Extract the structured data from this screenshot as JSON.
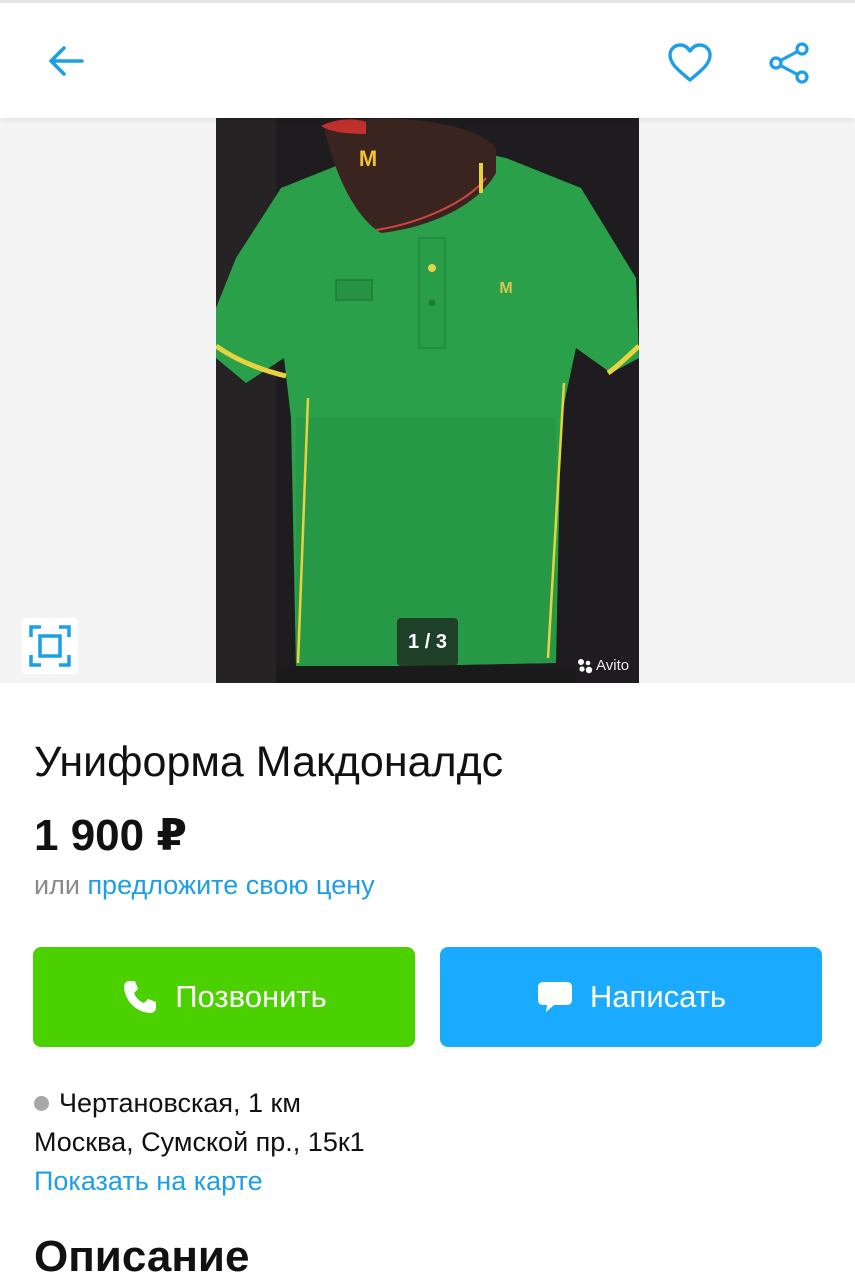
{
  "header": {
    "back_icon": "arrow-left-icon",
    "favorite_icon": "heart-outline-icon",
    "share_icon": "share-icon",
    "accent_color": "#1c9fe6"
  },
  "gallery": {
    "counter": "1 / 3",
    "watermark": "Avito",
    "current_index": 1,
    "total": 3,
    "fullscreen_icon": "fullscreen-icon",
    "cap_logo": "M",
    "shirt_logo": "M"
  },
  "listing": {
    "title": "Униформа Макдоналдс",
    "price": "1 900 ₽",
    "offer_prefix": "или",
    "offer_link": "предложите свою цену"
  },
  "actions": {
    "call_label": "Позвонить",
    "call_icon": "phone-icon",
    "call_color": "#4bd000",
    "message_label": "Написать",
    "message_icon": "chat-bubble-icon",
    "message_color": "#1aabff"
  },
  "location": {
    "metro": "Чертановская, 1 км",
    "address": "Москва, Сумской пр., 15к1",
    "map_link": "Показать на карте"
  },
  "description": {
    "heading": "Описание"
  }
}
